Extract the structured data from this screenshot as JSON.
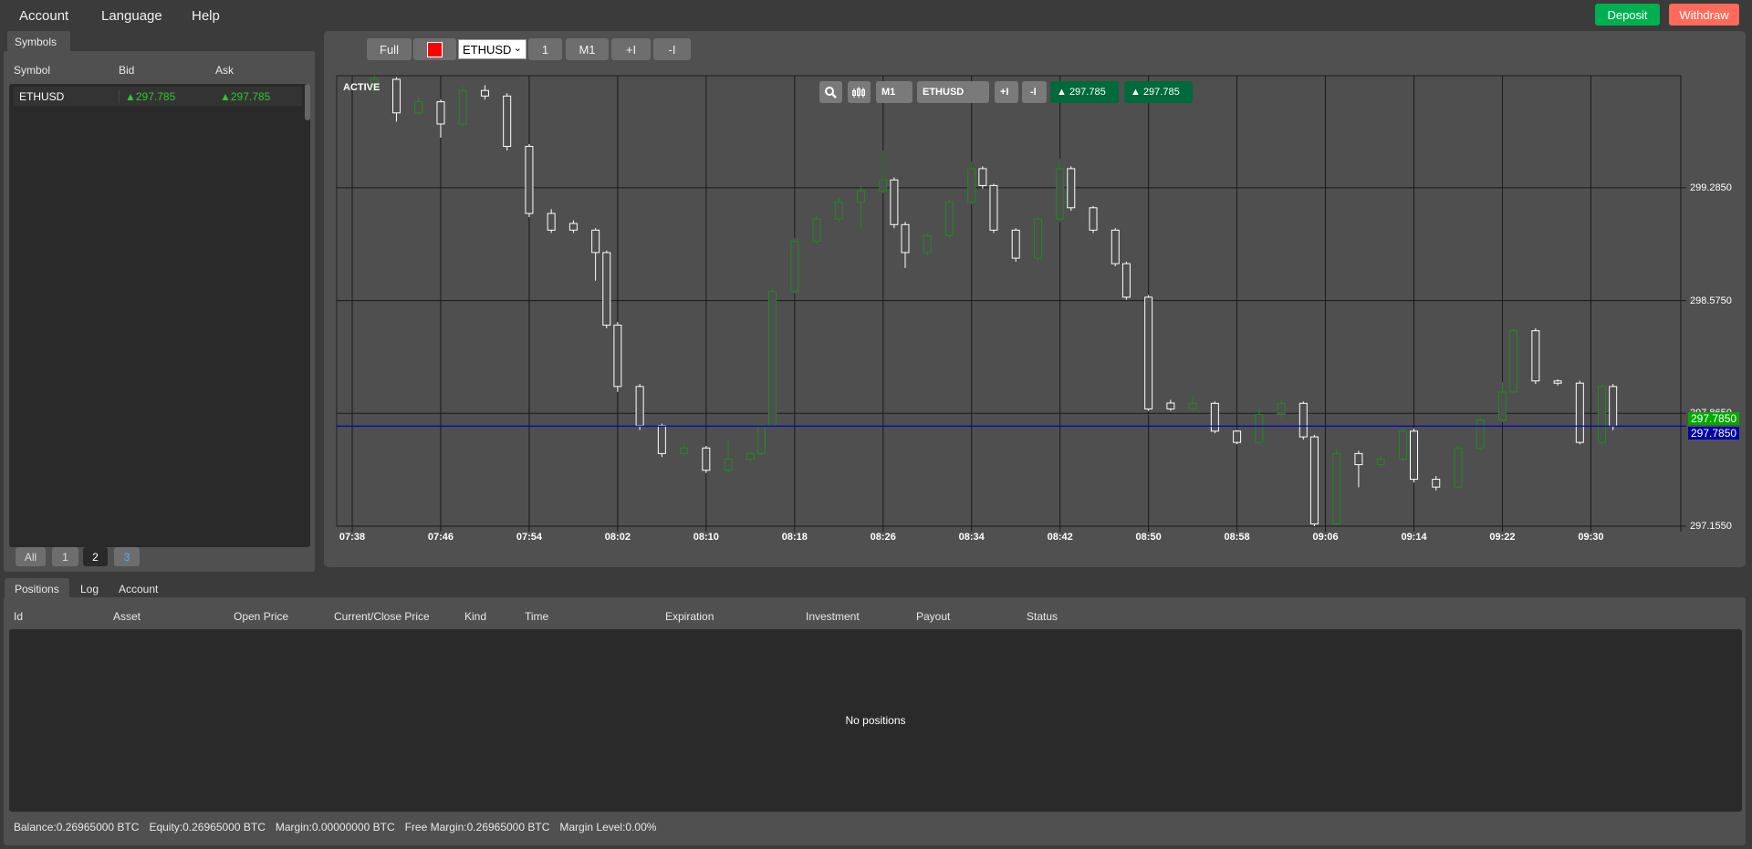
{
  "menu": {
    "items": [
      "Account",
      "Language",
      "Help"
    ]
  },
  "top_buttons": {
    "deposit": "Deposit",
    "withdraw": "Withdraw",
    "deposit_color": "#00b050",
    "withdraw_color": "#ff6a5a"
  },
  "symbols_panel": {
    "tab": "Symbols",
    "columns": [
      "Symbol",
      "Bid",
      "Ask"
    ],
    "rows": [
      {
        "symbol": "ETHUSD",
        "bid": "▲297.785",
        "ask": "▲297.785"
      }
    ],
    "pages": [
      "All",
      "1",
      "2",
      "3"
    ],
    "active_page": "2"
  },
  "chart_toolbar": {
    "full": "Full",
    "color_swatch": "#ff0000",
    "symbol_select": "ETHUSD",
    "btn_1": "1",
    "timeframe": "M1",
    "zoom_in": "+I",
    "zoom_out": "-I"
  },
  "chart_overlay": {
    "status": "ACTIVE",
    "icons": [
      "search-zoom-icon",
      "candlestick-icon"
    ],
    "timeframe": "M1",
    "symbol": "ETHUSD",
    "zoom_in": "+I",
    "zoom_out": "-I",
    "bid": "▲ 297.785",
    "ask": "▲ 297.785"
  },
  "chart_data": {
    "type": "candlestick",
    "symbol": "ETHUSD",
    "timeframe": "M1",
    "x_ticks": [
      "07:38",
      "07:46",
      "07:54",
      "08:02",
      "08:10",
      "08:18",
      "08:26",
      "08:34",
      "08:42",
      "08:50",
      "08:58",
      "09:06",
      "09:14",
      "09:22",
      "09:30"
    ],
    "y_ticks": [
      "299.2850",
      "298.5750",
      "297.8650",
      "297.1550"
    ],
    "ylim": [
      297.155,
      299.99
    ],
    "grid": true,
    "current_price": {
      "bid_label": "297.7850",
      "ask_label": "297.7850",
      "value": 297.785,
      "bid_color": "#00aa00",
      "ask_color": "#0000aa"
    },
    "colors": {
      "up": "#1f8a1f",
      "down": "#ffffff",
      "price_line": "#0000cc"
    },
    "candles_fields": [
      "time",
      "open",
      "high",
      "low",
      "close"
    ],
    "candles": [
      [
        "07:40",
        299.9,
        299.99,
        299.88,
        299.967
      ],
      [
        "07:42",
        299.967,
        299.98,
        299.7,
        299.756
      ],
      [
        "07:44",
        299.756,
        299.85,
        299.74,
        299.826
      ],
      [
        "07:46",
        299.826,
        299.84,
        299.6,
        299.686
      ],
      [
        "07:48",
        299.686,
        299.92,
        299.67,
        299.897
      ],
      [
        "07:50",
        299.897,
        299.93,
        299.84,
        299.862
      ],
      [
        "07:52",
        299.862,
        299.88,
        299.52,
        299.545
      ],
      [
        "07:54",
        299.545,
        299.56,
        299.1,
        299.123
      ],
      [
        "07:56",
        299.123,
        299.15,
        299.0,
        299.018
      ],
      [
        "07:58",
        299.06,
        299.08,
        299.0,
        299.018
      ],
      [
        "08:00",
        299.018,
        299.03,
        298.7,
        298.877
      ],
      [
        "08:01",
        298.877,
        298.89,
        298.4,
        298.42
      ],
      [
        "08:02",
        298.42,
        298.44,
        298.0,
        298.034
      ],
      [
        "08:04",
        298.034,
        298.05,
        297.76,
        297.788
      ],
      [
        "08:06",
        297.788,
        297.8,
        297.59,
        297.612
      ],
      [
        "08:08",
        297.612,
        297.67,
        297.6,
        297.647
      ],
      [
        "08:10",
        297.647,
        297.66,
        297.49,
        297.507
      ],
      [
        "08:12",
        297.507,
        297.7,
        297.49,
        297.577
      ],
      [
        "08:14",
        297.577,
        297.63,
        297.56,
        297.612
      ],
      [
        "08:15",
        297.612,
        297.8,
        297.6,
        297.788
      ],
      [
        "08:16",
        297.788,
        298.65,
        297.78,
        298.631
      ],
      [
        "08:18",
        298.631,
        298.97,
        298.62,
        298.948
      ],
      [
        "08:20",
        298.948,
        299.11,
        298.93,
        299.088
      ],
      [
        "08:22",
        299.088,
        299.22,
        299.07,
        299.194
      ],
      [
        "08:24",
        299.194,
        299.3,
        299.02,
        299.264
      ],
      [
        "08:26",
        299.264,
        299.52,
        299.25,
        299.334
      ],
      [
        "08:27",
        299.334,
        299.35,
        299.03,
        299.053
      ],
      [
        "08:28",
        299.053,
        299.07,
        298.78,
        298.877
      ],
      [
        "08:30",
        298.877,
        299.0,
        298.86,
        298.983
      ],
      [
        "08:32",
        298.983,
        299.21,
        298.97,
        299.194
      ],
      [
        "08:34",
        299.194,
        299.45,
        299.18,
        299.405
      ],
      [
        "08:35",
        299.405,
        299.42,
        299.28,
        299.299
      ],
      [
        "08:36",
        299.299,
        299.31,
        299.0,
        299.018
      ],
      [
        "08:38",
        299.018,
        299.03,
        298.82,
        298.842
      ],
      [
        "08:40",
        298.842,
        299.1,
        298.83,
        299.088
      ],
      [
        "08:42",
        299.088,
        299.47,
        299.07,
        299.405
      ],
      [
        "08:43",
        299.405,
        299.42,
        299.14,
        299.159
      ],
      [
        "08:45",
        299.159,
        299.17,
        299.0,
        299.018
      ],
      [
        "08:47",
        299.018,
        299.03,
        298.79,
        298.807
      ],
      [
        "08:48",
        298.807,
        298.82,
        298.58,
        298.596
      ],
      [
        "08:50",
        298.596,
        298.61,
        297.88,
        297.893
      ],
      [
        "08:52",
        297.93,
        297.95,
        297.88,
        297.893
      ],
      [
        "08:54",
        297.893,
        297.97,
        297.88,
        297.928
      ],
      [
        "08:56",
        297.928,
        297.94,
        297.74,
        297.753
      ],
      [
        "08:58",
        297.753,
        297.76,
        297.67,
        297.682
      ],
      [
        "09:00",
        297.682,
        297.9,
        297.67,
        297.858
      ],
      [
        "09:02",
        297.858,
        297.95,
        297.84,
        297.928
      ],
      [
        "09:04",
        297.928,
        297.94,
        297.7,
        297.717
      ],
      [
        "09:05",
        297.717,
        297.73,
        297.155,
        297.169
      ],
      [
        "09:07",
        297.169,
        297.64,
        297.16,
        297.612
      ],
      [
        "09:09",
        297.612,
        297.63,
        297.4,
        297.542
      ],
      [
        "09:11",
        297.542,
        297.6,
        297.53,
        297.577
      ],
      [
        "09:13",
        297.577,
        297.77,
        297.56,
        297.753
      ],
      [
        "09:14",
        297.753,
        297.77,
        297.43,
        297.45
      ],
      [
        "09:16",
        297.45,
        297.47,
        297.38,
        297.401
      ],
      [
        "09:18",
        297.401,
        297.66,
        297.39,
        297.647
      ],
      [
        "09:20",
        297.647,
        297.84,
        297.63,
        297.823
      ],
      [
        "09:22",
        297.823,
        298.06,
        297.81,
        297.999
      ],
      [
        "09:23",
        297.999,
        298.4,
        297.99,
        298.385
      ],
      [
        "09:25",
        298.385,
        298.4,
        298.05,
        298.069
      ],
      [
        "09:27",
        298.069,
        298.08,
        298.04,
        298.055
      ],
      [
        "09:29",
        298.055,
        298.07,
        297.67,
        297.682
      ],
      [
        "09:31",
        297.682,
        298.05,
        297.67,
        298.034
      ],
      [
        "09:32",
        298.034,
        298.05,
        297.76,
        297.785
      ]
    ]
  },
  "bottom_panel": {
    "tabs": [
      "Positions",
      "Log",
      "Account"
    ],
    "active_tab": "Positions",
    "columns": [
      "Id",
      "Asset",
      "Open Price",
      "Current/Close Price",
      "Kind",
      "Time",
      "Expiration",
      "Investment",
      "Payout",
      "Status"
    ],
    "empty_message": "No positions",
    "status_bar": {
      "balance": "Balance:0.26965000 BTC",
      "equity": "Equity:0.26965000 BTC",
      "margin": "Margin:0.00000000 BTC",
      "free_margin": "Free Margin:0.26965000 BTC",
      "margin_level": "Margin Level:0.00%"
    }
  }
}
